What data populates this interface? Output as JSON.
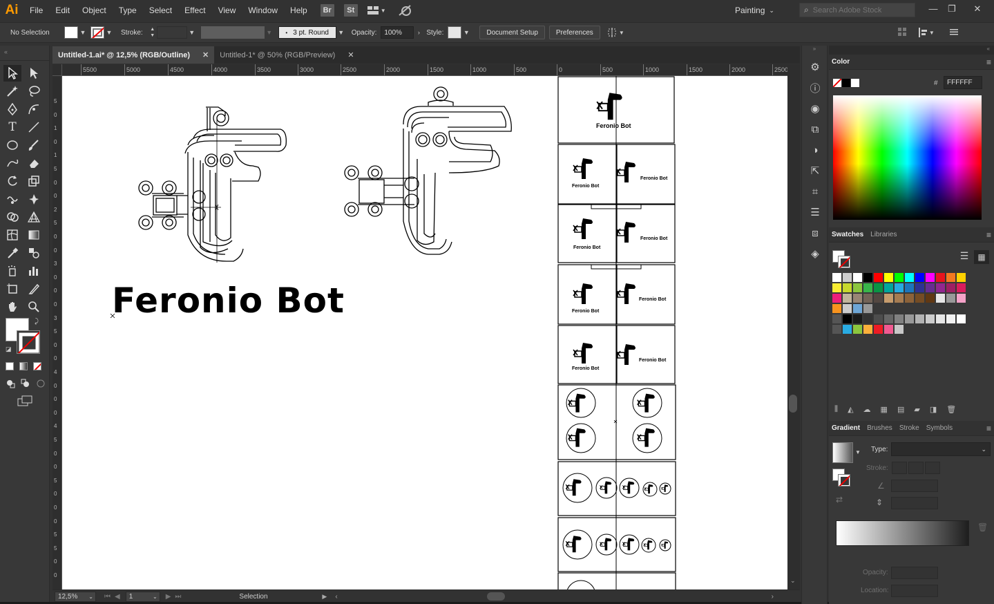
{
  "app": {
    "logo": "Ai",
    "menus": [
      "File",
      "Edit",
      "Object",
      "Type",
      "Select",
      "Effect",
      "View",
      "Window",
      "Help"
    ],
    "bridge_label": "Br",
    "stock_label": "St",
    "workspace": "Painting",
    "search_placeholder": "Search Adobe Stock",
    "window_controls": [
      "—",
      "❐",
      "✕"
    ]
  },
  "control_bar": {
    "selection_label": "No Selection",
    "stroke_label": "Stroke:",
    "brush_profile": "3 pt. Round",
    "opacity_label": "Opacity:",
    "opacity_value": "100%",
    "style_label": "Style:",
    "document_setup": "Document Setup",
    "preferences": "Preferences"
  },
  "tabs": [
    {
      "label": "Untitled-1.ai* @ 12,5% (RGB/Outline)",
      "active": true
    },
    {
      "label": "Untitled-1* @ 50% (RGB/Preview)",
      "active": false
    }
  ],
  "ruler": {
    "top_ticks": [
      "5500",
      "5000",
      "4500",
      "4000",
      "3500",
      "3000",
      "2500",
      "2000",
      "1500",
      "1000",
      "500",
      "0",
      "500",
      "1000",
      "1500",
      "2000",
      "2500"
    ],
    "left_ticks": [
      "5",
      "0",
      "1",
      "0",
      "1",
      "5",
      "0",
      "0",
      "2",
      "5",
      "0",
      "0",
      "3",
      "0",
      "0",
      "0",
      "3",
      "5",
      "0",
      "0",
      "4",
      "0",
      "0",
      "0",
      "4",
      "5",
      "0",
      "0",
      "5",
      "0",
      "0",
      "0",
      "5",
      "5",
      "0",
      "0"
    ]
  },
  "canvas": {
    "logo_text": "Feronio Bot",
    "board_caption": "Feronio Bot"
  },
  "status": {
    "zoom": "12,5%",
    "page": "1",
    "tool": "Selection"
  },
  "color_panel": {
    "title": "Color",
    "hex_prefix": "#",
    "hex": "FFFFFF"
  },
  "swatches_panel": {
    "tabs": [
      "Swatches",
      "Libraries"
    ],
    "rows": [
      [
        "#ffffff",
        "#cccccc",
        "#ffffff",
        "#000000",
        "#ff0000",
        "#ffff00",
        "#00ff00",
        "#00ffff",
        "#0000ff",
        "#ff00ff",
        "#e8141e",
        "#f47920",
        "#ffd200"
      ],
      [
        "#f9ed32",
        "#c7d92c",
        "#8cc63e",
        "#39b54a",
        "#0a9444",
        "#00a79d",
        "#27aae1",
        "#1c75bc",
        "#2e3192",
        "#662d91",
        "#92278f",
        "#9e1f63",
        "#d91c5c"
      ],
      [
        "#ed1e79",
        "#c2b59b",
        "#998675",
        "#736357",
        "#534741",
        "#c69c6d",
        "#a67c52",
        "#8c6239",
        "#754c24",
        "#603813",
        "#e6e6e6",
        "#999999",
        "#f5a2c8"
      ],
      [
        "#f7931e",
        "#cccccc",
        "#6ea6d6",
        "#999999"
      ],
      [
        "#555555",
        "#000000",
        "#1a1a1a",
        "#333333",
        "#4d4d4d",
        "#666666",
        "#808080",
        "#999999",
        "#b3b3b3",
        "#cccccc",
        "#e6e6e6",
        "#f2f2f2",
        "#ffffff"
      ],
      [
        "#555555",
        "#29abe2",
        "#8cc63e",
        "#fbb03b",
        "#ed1c24",
        "#f15a91",
        "#c8c8c8"
      ]
    ]
  },
  "gradient_panel": {
    "tabs": [
      "Gradient",
      "Brushes",
      "Stroke",
      "Symbols"
    ],
    "type_label": "Type:",
    "stroke_label": "Stroke:",
    "opacity_label": "Opacity:",
    "location_label": "Location:"
  },
  "colors": {
    "accent": "#ff9a00",
    "chrome": "#323232",
    "panel": "#383838"
  }
}
